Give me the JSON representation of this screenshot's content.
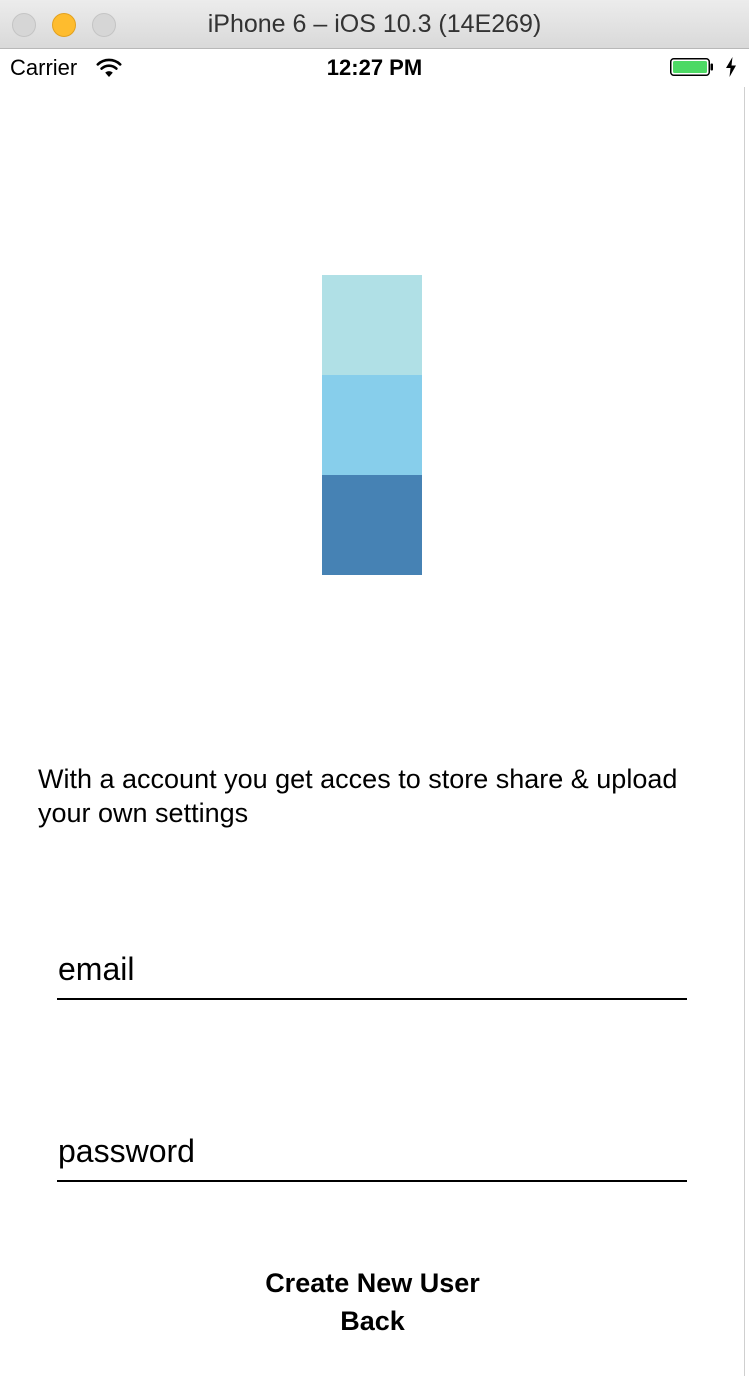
{
  "window": {
    "title": "iPhone 6 – iOS 10.3 (14E269)"
  },
  "status_bar": {
    "carrier": "Carrier",
    "time": "12:27 PM",
    "icons": [
      "wifi-icon",
      "battery-icon",
      "charging-bolt-icon"
    ],
    "battery_level": 1.0,
    "battery_color": "#4cd964"
  },
  "logo": {
    "blocks": [
      {
        "color": "#b0e0e6"
      },
      {
        "color": "#87ceeb"
      },
      {
        "color": "#4682b4"
      }
    ]
  },
  "main": {
    "description": "With a account you get acces to store share & upload your own settings",
    "email_field": {
      "placeholder": "email",
      "value": ""
    },
    "password_field": {
      "placeholder": "password",
      "value": ""
    },
    "create_button_label": "Create New User",
    "back_button_label": "Back"
  }
}
